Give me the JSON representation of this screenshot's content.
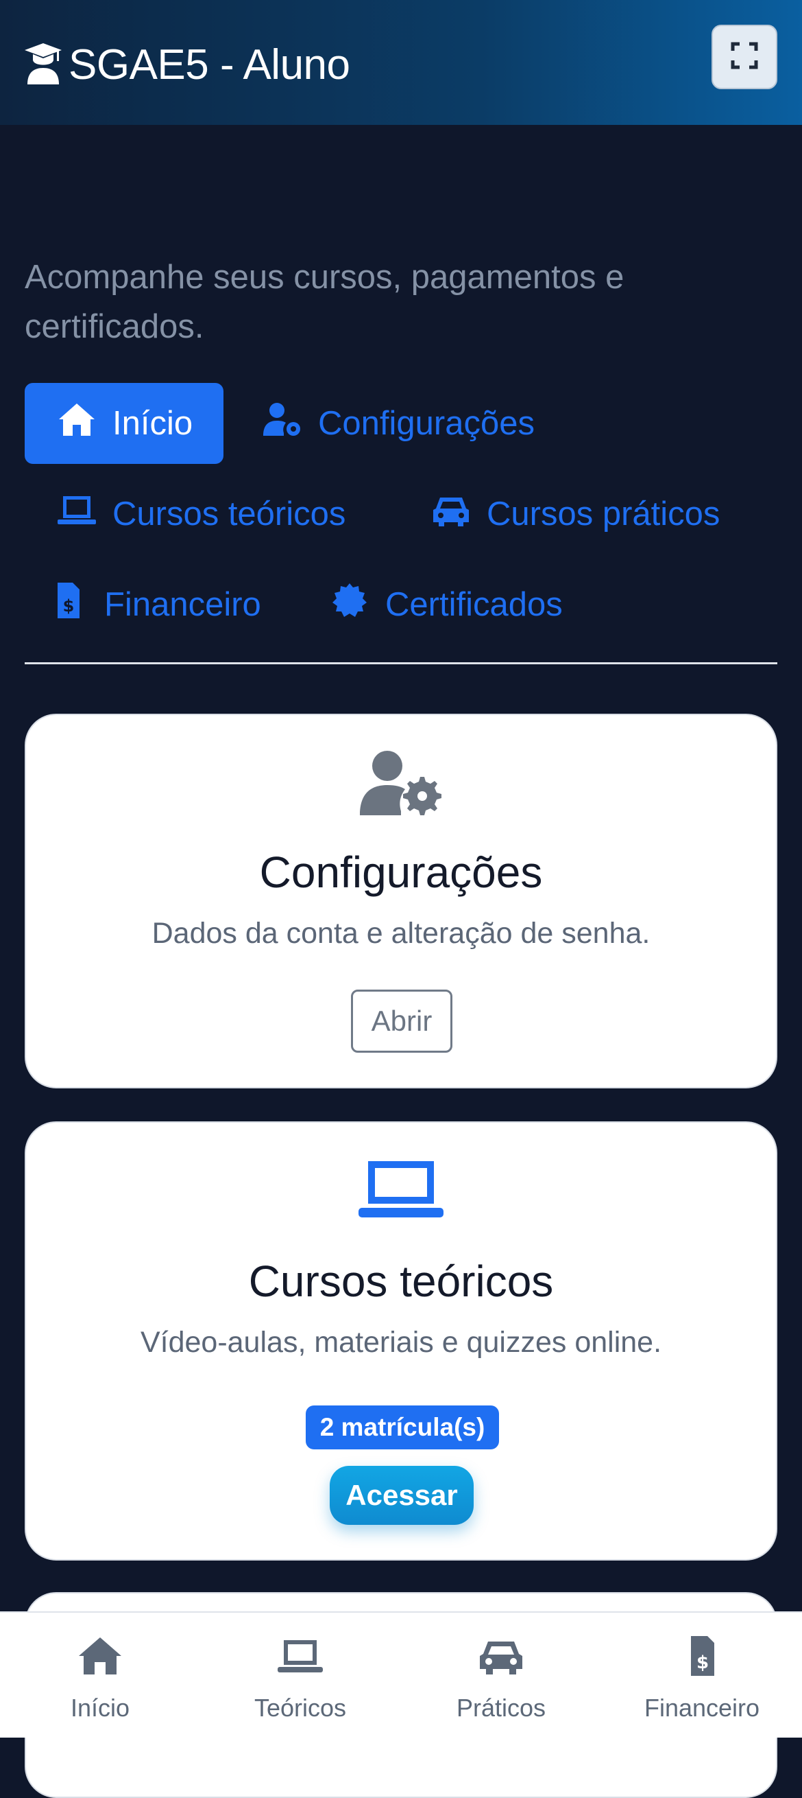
{
  "header": {
    "title": "SGAE5 - Aluno",
    "brand_icon": "graduate-icon",
    "fullscreen_icon": "expand-icon"
  },
  "intro": {
    "subtitle": "Acompanhe seus cursos, pagamentos e certificados."
  },
  "tabs": [
    {
      "label": "Início",
      "icon": "home-icon",
      "active": true
    },
    {
      "label": "Configurações",
      "icon": "user-gear-icon"
    },
    {
      "label": "Cursos teóricos",
      "icon": "laptop-icon"
    },
    {
      "label": "Cursos práticos",
      "icon": "car-icon"
    },
    {
      "label": "Financeiro",
      "icon": "invoice-dollar-icon"
    },
    {
      "label": "Certificados",
      "icon": "certificate-icon"
    }
  ],
  "cards": [
    {
      "title": "Configurações",
      "description": "Dados da conta e alteração de senha.",
      "button": "Abrir",
      "icon": "user-gear-icon"
    },
    {
      "title": "Cursos teóricos",
      "description": "Vídeo-aulas, materiais e quizzes online.",
      "badge": "2 matrícula(s)",
      "button": "Acessar",
      "icon": "laptop-icon"
    }
  ],
  "bottom_nav": [
    {
      "label": "Início",
      "icon": "home-icon"
    },
    {
      "label": "Teóricos",
      "icon": "laptop-icon"
    },
    {
      "label": "Práticos",
      "icon": "car-icon"
    },
    {
      "label": "Financeiro",
      "icon": "invoice-dollar-icon"
    }
  ],
  "colors": {
    "primary": "#1f6ff2",
    "accent": "#0f8bd0",
    "background": "#0f172b"
  }
}
